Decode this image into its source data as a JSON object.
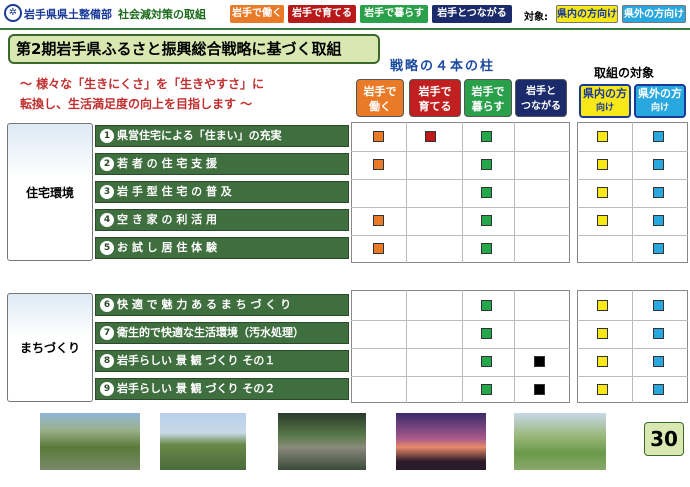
{
  "header": {
    "org_name": "岩手県県土整備部",
    "section_title": "社会減対策の取組",
    "tags": [
      {
        "label": "岩手で働く",
        "color": "#e87a28"
      },
      {
        "label": "岩手で育てる",
        "color": "#b81a1a"
      },
      {
        "label": "岩手で暮らす",
        "color": "#2aa04a"
      },
      {
        "label": "岩手とつながる",
        "color": "#1a2a6a"
      }
    ],
    "target_label": "対象:",
    "target_tags": [
      {
        "label": "県内の方向け",
        "color": "#f8e818"
      },
      {
        "label": "県外の方向け",
        "color": "#29a8e0"
      }
    ]
  },
  "main_title": "第2期岩手県ふるさと振興総合戦略に基づく取組",
  "subtitle_lines": [
    "～ 様々な「生きにくさ」を「生きやすさ」に",
    "転換し、生活満足度の向上を目指します ～"
  ],
  "pillar_title": "戦略の４本の柱",
  "target_title": "取組の対象",
  "pillars": [
    {
      "line1": "岩手で",
      "line2": "働く",
      "color": "#e87a28"
    },
    {
      "line1": "岩手で",
      "line2": "育てる",
      "color": "#c02020"
    },
    {
      "line1": "岩手で",
      "line2": "暮らす",
      "color": "#2aa04a"
    },
    {
      "line1": "岩手と",
      "line2": "つながる",
      "color": "#1a2a6a"
    }
  ],
  "targets": [
    {
      "line1": "県内の方",
      "line2": "向け",
      "color": "#f8e818"
    },
    {
      "line1": "県外の方",
      "line2": "向け",
      "color": "#29a8e0"
    }
  ],
  "groups": [
    {
      "label": "住宅環境"
    },
    {
      "label": "まちづくり"
    }
  ],
  "items": [
    {
      "num": "1",
      "label": "県営住宅による「住まい」の充実",
      "marks": [
        "orange",
        "red",
        "green",
        null
      ],
      "targets": [
        "yellow",
        "blue"
      ]
    },
    {
      "num": "2",
      "label": "若 者 の 住 宅 支 援",
      "marks": [
        "orange",
        null,
        "green",
        null
      ],
      "targets": [
        "yellow",
        "blue"
      ]
    },
    {
      "num": "3",
      "label": "岩 手 型 住 宅 の 普 及",
      "marks": [
        null,
        null,
        "green",
        null
      ],
      "targets": [
        "yellow",
        "blue"
      ]
    },
    {
      "num": "4",
      "label": "空 き 家 の 利 活 用",
      "marks": [
        "orange",
        null,
        "green",
        null
      ],
      "targets": [
        "yellow",
        "blue"
      ]
    },
    {
      "num": "5",
      "label": "お 試 し 居 住 体 験",
      "marks": [
        "orange",
        null,
        "green",
        null
      ],
      "targets": [
        null,
        "blue"
      ]
    },
    {
      "num": "6",
      "label": "快 適 で 魅 力 あ る ま ち づ く り",
      "marks": [
        null,
        null,
        "green",
        null
      ],
      "targets": [
        "yellow",
        "blue"
      ]
    },
    {
      "num": "7",
      "label": "衛生的で快適な生活環境（汚水処理）",
      "marks": [
        null,
        null,
        "green",
        null
      ],
      "targets": [
        "yellow",
        "blue"
      ]
    },
    {
      "num": "8",
      "label": "岩手らしい 景 観 づくり その１",
      "marks": [
        null,
        null,
        "green",
        "black"
      ],
      "targets": [
        "yellow",
        "blue"
      ]
    },
    {
      "num": "9",
      "label": "岩手らしい 景 観 づくり その２",
      "marks": [
        null,
        null,
        "green",
        "black"
      ],
      "targets": [
        "yellow",
        "blue"
      ]
    }
  ],
  "mark_colors": {
    "orange": "#e87a28",
    "red": "#c01818",
    "green": "#22a84a",
    "black": "#000000",
    "yellow": "#f8e818",
    "blue": "#29a8e0"
  },
  "page_number": "30"
}
